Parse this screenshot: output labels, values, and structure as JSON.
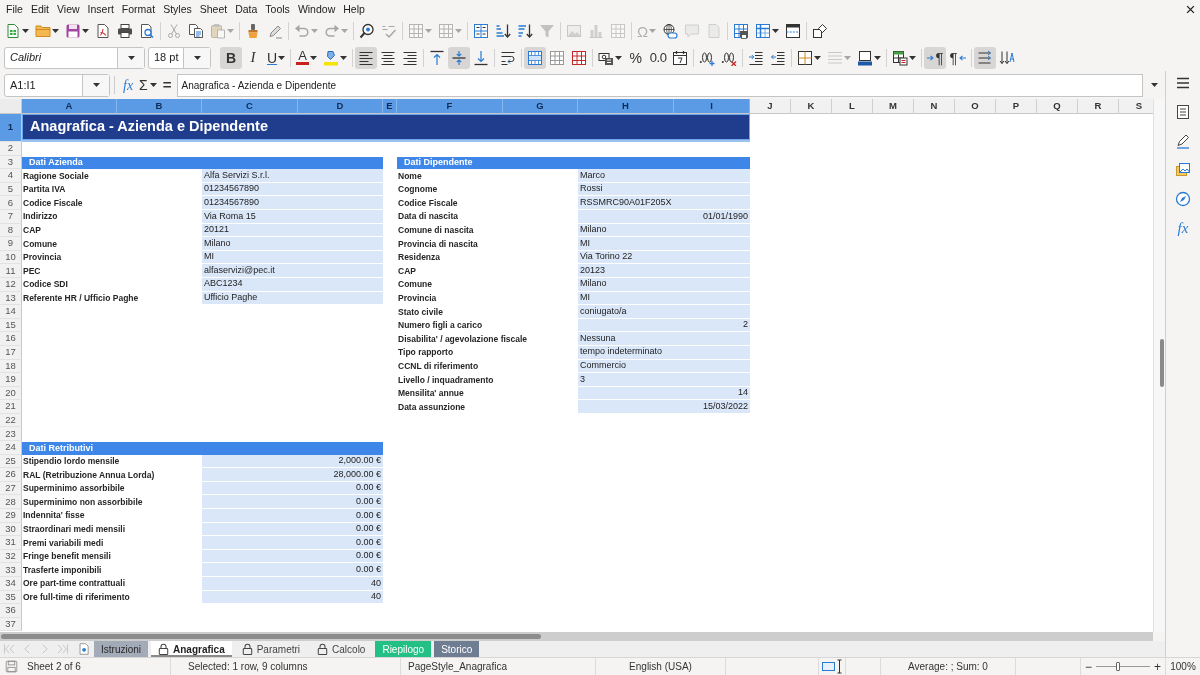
{
  "menu_bar": [
    "File",
    "Edit",
    "View",
    "Insert",
    "Format",
    "Styles",
    "Sheet",
    "Data",
    "Tools",
    "Window",
    "Help"
  ],
  "standard_toolbar": {
    "groups": [
      [
        {
          "kind": "new-doc",
          "disabled": false,
          "dropdown": true
        },
        {
          "kind": "open",
          "disabled": false,
          "dropdown": true
        },
        {
          "kind": "save",
          "disabled": false,
          "dropdown": true
        },
        {
          "kind": "export-pdf",
          "disabled": false
        },
        {
          "kind": "print",
          "disabled": false
        },
        {
          "kind": "print-preview",
          "disabled": false
        }
      ],
      [
        {
          "kind": "cut",
          "disabled": true
        },
        {
          "kind": "copy",
          "disabled": false
        },
        {
          "kind": "paste",
          "disabled": true,
          "dropdown": true
        }
      ],
      [
        {
          "kind": "clone-format",
          "disabled": false
        },
        {
          "kind": "clear-format",
          "disabled": false
        }
      ],
      [
        {
          "kind": "undo",
          "disabled": true,
          "dropdown": true
        },
        {
          "kind": "redo",
          "disabled": true,
          "dropdown": true
        }
      ],
      [
        {
          "kind": "find-replace",
          "disabled": false
        },
        {
          "kind": "spelling",
          "disabled": true
        }
      ],
      [
        {
          "kind": "rows",
          "disabled": true,
          "dropdown": true
        },
        {
          "kind": "columns",
          "disabled": true,
          "dropdown": true
        }
      ],
      [
        {
          "kind": "sort",
          "disabled": false
        },
        {
          "kind": "sort-asc",
          "disabled": false
        },
        {
          "kind": "sort-desc",
          "disabled": false
        },
        {
          "kind": "autofilter",
          "disabled": true
        }
      ],
      [
        {
          "kind": "image",
          "disabled": true
        },
        {
          "kind": "chart",
          "disabled": true
        },
        {
          "kind": "pivot",
          "disabled": true
        }
      ],
      [
        {
          "kind": "special-char",
          "label": "Ω",
          "disabled": true,
          "dropdown": true
        },
        {
          "kind": "hyperlink",
          "disabled": false
        },
        {
          "kind": "comment",
          "disabled": true
        },
        {
          "kind": "header-footer",
          "disabled": true
        }
      ],
      [
        {
          "kind": "print-area",
          "disabled": false
        },
        {
          "kind": "freeze",
          "disabled": false,
          "dropdown": true
        },
        {
          "kind": "split",
          "disabled": false
        }
      ],
      [
        {
          "kind": "draw-functions",
          "disabled": false
        }
      ]
    ]
  },
  "formatting_toolbar": {
    "font_name": "Calibri",
    "font_size": "18 pt",
    "groups": [
      [
        {
          "kind": "bold",
          "label": "B",
          "on": true,
          "disabled": false
        },
        {
          "kind": "italic",
          "label": "I",
          "on": false,
          "disabled": false
        },
        {
          "kind": "underline",
          "label": "U",
          "on": false,
          "disabled": false,
          "dropdown": true
        }
      ],
      [
        {
          "kind": "font-color",
          "label": "A",
          "disabled": false,
          "dropdown": true
        },
        {
          "kind": "highlight",
          "disabled": false,
          "dropdown": true
        }
      ],
      [
        {
          "kind": "align-left",
          "on": true,
          "disabled": false
        },
        {
          "kind": "align-center",
          "on": false,
          "disabled": false
        },
        {
          "kind": "align-right",
          "on": false,
          "disabled": false
        }
      ],
      [
        {
          "kind": "align-top",
          "on": false,
          "disabled": false
        },
        {
          "kind": "align-middle",
          "on": true,
          "disabled": false
        },
        {
          "kind": "align-bottom",
          "on": false,
          "disabled": false
        }
      ],
      [
        {
          "kind": "wrap",
          "on": false,
          "disabled": false
        }
      ],
      [
        {
          "kind": "merge-center",
          "on": true,
          "disabled": false
        },
        {
          "kind": "merge",
          "on": false,
          "disabled": false
        },
        {
          "kind": "unmerge",
          "on": false,
          "disabled": false
        }
      ],
      [
        {
          "kind": "currency",
          "disabled": false,
          "dropdown": true
        },
        {
          "kind": "percent",
          "label": "%",
          "disabled": false
        },
        {
          "kind": "number",
          "label": "0.0",
          "disabled": false
        },
        {
          "kind": "date",
          "disabled": false
        }
      ],
      [
        {
          "kind": "add-decimal",
          "disabled": false
        },
        {
          "kind": "delete-decimal",
          "disabled": false
        }
      ],
      [
        {
          "kind": "indent-increase",
          "disabled": false
        },
        {
          "kind": "indent-decrease",
          "disabled": false
        }
      ],
      [
        {
          "kind": "borders",
          "disabled": false,
          "dropdown": true
        },
        {
          "kind": "border-style",
          "disabled": true,
          "dropdown": true
        },
        {
          "kind": "border-color",
          "disabled": false,
          "dropdown": true
        }
      ],
      [
        {
          "kind": "conditional",
          "disabled": false,
          "dropdown": true
        }
      ],
      [
        {
          "kind": "ltr",
          "label": "¶",
          "on": true,
          "disabled": false
        },
        {
          "kind": "rtl",
          "label": "¶",
          "on": false,
          "disabled": false
        }
      ],
      [
        {
          "kind": "text-ltr",
          "on": true,
          "disabled": false
        },
        {
          "kind": "text-ttb",
          "on": false,
          "disabled": false
        }
      ]
    ]
  },
  "formula_bar": {
    "name_box": "A1:I1",
    "function_wizard": "fx",
    "sum": "Σ",
    "formula": "=",
    "content": "Anagrafica - Azienda e Dipendente"
  },
  "sidebar": [
    {
      "kind": "properties",
      "selected": false
    },
    {
      "kind": "styles",
      "selected": false
    },
    {
      "kind": "gallery",
      "selected": false
    },
    {
      "kind": "navigator",
      "selected": false
    },
    {
      "kind": "functions",
      "label": "fx",
      "selected": false
    }
  ],
  "sheet": {
    "columns": [
      {
        "label": "A",
        "selected": true
      },
      {
        "label": "B",
        "selected": true
      },
      {
        "label": "C",
        "selected": true
      },
      {
        "label": "D",
        "selected": true
      },
      {
        "label": "E",
        "selected": true
      },
      {
        "label": "F",
        "selected": true
      },
      {
        "label": "G",
        "selected": true
      },
      {
        "label": "H",
        "selected": true
      },
      {
        "label": "I",
        "selected": true
      },
      {
        "label": "J",
        "selected": false
      },
      {
        "label": "K",
        "selected": false
      },
      {
        "label": "L",
        "selected": false
      },
      {
        "label": "M",
        "selected": false
      },
      {
        "label": "N",
        "selected": false
      },
      {
        "label": "O",
        "selected": false
      },
      {
        "label": "P",
        "selected": false
      },
      {
        "label": "Q",
        "selected": false
      },
      {
        "label": "R",
        "selected": false
      },
      {
        "label": "S",
        "selected": false
      }
    ],
    "rows": [
      {
        "label": "1",
        "selected": true
      },
      {
        "label": "2",
        "selected": false
      },
      {
        "label": "3",
        "selected": false
      },
      {
        "label": "4",
        "selected": false
      },
      {
        "label": "5",
        "selected": false
      },
      {
        "label": "6",
        "selected": false
      },
      {
        "label": "7",
        "selected": false
      },
      {
        "label": "8",
        "selected": false
      },
      {
        "label": "9",
        "selected": false
      },
      {
        "label": "10",
        "selected": false
      },
      {
        "label": "11",
        "selected": false
      },
      {
        "label": "12",
        "selected": false
      },
      {
        "label": "13",
        "selected": false
      },
      {
        "label": "14",
        "selected": false
      },
      {
        "label": "15",
        "selected": false
      },
      {
        "label": "16",
        "selected": false
      },
      {
        "label": "17",
        "selected": false
      },
      {
        "label": "18",
        "selected": false
      },
      {
        "label": "19",
        "selected": false
      },
      {
        "label": "20",
        "selected": false
      },
      {
        "label": "21",
        "selected": false
      },
      {
        "label": "22",
        "selected": false
      },
      {
        "label": "23",
        "selected": false
      },
      {
        "label": "24",
        "selected": false
      },
      {
        "label": "25",
        "selected": false
      },
      {
        "label": "26",
        "selected": false
      },
      {
        "label": "27",
        "selected": false
      },
      {
        "label": "28",
        "selected": false
      },
      {
        "label": "29",
        "selected": false
      },
      {
        "label": "30",
        "selected": false
      },
      {
        "label": "31",
        "selected": false
      },
      {
        "label": "32",
        "selected": false
      },
      {
        "label": "33",
        "selected": false
      },
      {
        "label": "34",
        "selected": false
      },
      {
        "label": "35",
        "selected": false
      },
      {
        "label": "36",
        "selected": false
      },
      {
        "label": "37",
        "selected": false
      }
    ],
    "title": {
      "text": "Anagrafica - Azienda e Dipendente",
      "selected": true
    },
    "sections": [
      {
        "title": "Dati Azienda",
        "fields": [
          {
            "label": "Ragione Sociale",
            "value": "Alfa Servizi S.r.l.",
            "kind": "text"
          },
          {
            "label": "Partita IVA",
            "value": "01234567890",
            "kind": "text"
          },
          {
            "label": "Codice Fiscale",
            "value": "01234567890",
            "kind": "text"
          },
          {
            "label": "Indirizzo",
            "value": "Via Roma 15",
            "kind": "text"
          },
          {
            "label": "CAP",
            "value": "20121",
            "kind": "text"
          },
          {
            "label": "Comune",
            "value": "Milano",
            "kind": "text"
          },
          {
            "label": "Provincia",
            "value": "MI",
            "kind": "text"
          },
          {
            "label": "PEC",
            "value": "alfaservizi@pec.it",
            "kind": "text"
          },
          {
            "label": "Codice SDI",
            "value": "ABC1234",
            "kind": "text"
          },
          {
            "label": "Referente HR / Ufficio Paghe",
            "value": "Ufficio Paghe",
            "kind": "text"
          }
        ]
      },
      {
        "title": "Dati Dipendente",
        "fields": [
          {
            "label": "Nome",
            "value": "Marco",
            "kind": "text"
          },
          {
            "label": "Cognome",
            "value": "Rossi",
            "kind": "text"
          },
          {
            "label": "Codice Fiscale",
            "value": "RSSMRC90A01F205X",
            "kind": "text"
          },
          {
            "label": "Data di nascita",
            "value": "01/01/1990",
            "kind": "number"
          },
          {
            "label": "Comune di nascita",
            "value": "Milano",
            "kind": "text"
          },
          {
            "label": "Provincia di nascita",
            "value": "MI",
            "kind": "text"
          },
          {
            "label": "Residenza",
            "value": "Via Torino 22",
            "kind": "text"
          },
          {
            "label": "CAP",
            "value": "20123",
            "kind": "text"
          },
          {
            "label": "Comune",
            "value": "Milano",
            "kind": "text"
          },
          {
            "label": "Provincia",
            "value": "MI",
            "kind": "text"
          },
          {
            "label": "Stato civile",
            "value": "coniugato/a",
            "kind": "text"
          },
          {
            "label": "Numero figli a carico",
            "value": "2",
            "kind": "number"
          },
          {
            "label": "Disabilita' / agevolazione fiscale",
            "value": "Nessuna",
            "kind": "text"
          },
          {
            "label": "Tipo rapporto",
            "value": "tempo indeterminato",
            "kind": "text"
          },
          {
            "label": "CCNL di riferimento",
            "value": "Commercio",
            "kind": "text"
          },
          {
            "label": "Livello / inquadramento",
            "value": "3",
            "kind": "text"
          },
          {
            "label": "Mensilita' annue",
            "value": "14",
            "kind": "number"
          },
          {
            "label": "Data assunzione",
            "value": "15/03/2022",
            "kind": "number"
          }
        ]
      },
      {
        "title": "Dati Retributivi",
        "fields": [
          {
            "label": "Stipendio lordo mensile",
            "value": "2,000.00 €",
            "kind": "number"
          },
          {
            "label": "RAL (Retribuzione Annua Lorda)",
            "value": "28,000.00 €",
            "kind": "number"
          },
          {
            "label": "Superminimo assorbibile",
            "value": "0.00 €",
            "kind": "number"
          },
          {
            "label": "Superminimo non assorbibile",
            "value": "0.00 €",
            "kind": "number"
          },
          {
            "label": "Indennita' fisse",
            "value": "0.00 €",
            "kind": "number"
          },
          {
            "label": "Straordinari medi mensili",
            "value": "0.00 €",
            "kind": "number"
          },
          {
            "label": "Premi variabili medi",
            "value": "0.00 €",
            "kind": "number"
          },
          {
            "label": "Fringe benefit mensili",
            "value": "0.00 €",
            "kind": "number"
          },
          {
            "label": "Trasferte imponibili",
            "value": "0.00 €",
            "kind": "number"
          },
          {
            "label": "Ore part-time contrattuali",
            "value": "40",
            "kind": "number"
          },
          {
            "label": "Ore full-time di riferimento",
            "value": "40",
            "kind": "number"
          }
        ]
      }
    ]
  },
  "sheet_tabs": {
    "navigation_disabled": true,
    "tabs": [
      {
        "label": "Istruzioni",
        "selected": false,
        "locked": false,
        "color": "#a3abb8"
      },
      {
        "label": "Anagrafica",
        "selected": true,
        "locked": true
      },
      {
        "label": "Parametri",
        "selected": false,
        "locked": true
      },
      {
        "label": "Calcolo",
        "selected": false,
        "locked": true
      },
      {
        "label": "Riepilogo",
        "selected": false,
        "locked": false,
        "color": "#22c084"
      },
      {
        "label": "Storico",
        "selected": false,
        "locked": false,
        "color": "#6f7d92"
      }
    ]
  },
  "status_bar": {
    "sheet": "Sheet 2 of 6",
    "selection": "Selected: 1 row, 9 columns",
    "page_style": "PageStyle_Anagrafica",
    "language": "English (USA)",
    "summary": "Average: ; Sum: 0",
    "zoom_out": "−",
    "zoom": {
      "level": 0.4
    },
    "zoom_in": "+",
    "zoom_percent": "100%"
  }
}
